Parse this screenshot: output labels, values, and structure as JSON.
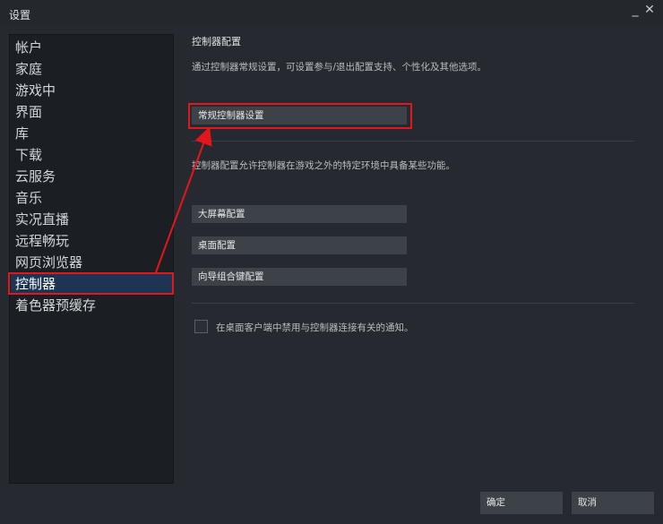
{
  "window": {
    "title": "设置",
    "minimize": "_",
    "close": "✕"
  },
  "sidebar": {
    "items": [
      {
        "label": "帐户"
      },
      {
        "label": "家庭"
      },
      {
        "label": "游戏中"
      },
      {
        "label": "界面"
      },
      {
        "label": "库"
      },
      {
        "label": "下载"
      },
      {
        "label": "云服务"
      },
      {
        "label": "音乐"
      },
      {
        "label": "实况直播"
      },
      {
        "label": "远程畅玩"
      },
      {
        "label": "网页浏览器"
      },
      {
        "label": "控制器"
      },
      {
        "label": "着色器预缓存"
      }
    ],
    "active_index": 11
  },
  "main": {
    "section_title": "控制器配置",
    "intro": "通过控制器常规设置，可设置参与/退出配置支持、个性化及其他选项。",
    "general_button": "常规控制器设置",
    "config_desc": "控制器配置允许控制器在游戏之外的特定环境中具备某些功能。",
    "big_picture_button": "大屏幕配置",
    "desktop_button": "桌面配置",
    "guide_chord_button": "向导组合键配置",
    "notification_checkbox": {
      "label": "在桌面客户端中禁用与控制器连接有关的通知。",
      "checked": false
    }
  },
  "footer": {
    "ok": "确定",
    "cancel": "取消"
  },
  "annotation": {
    "color": "#e3161c"
  }
}
